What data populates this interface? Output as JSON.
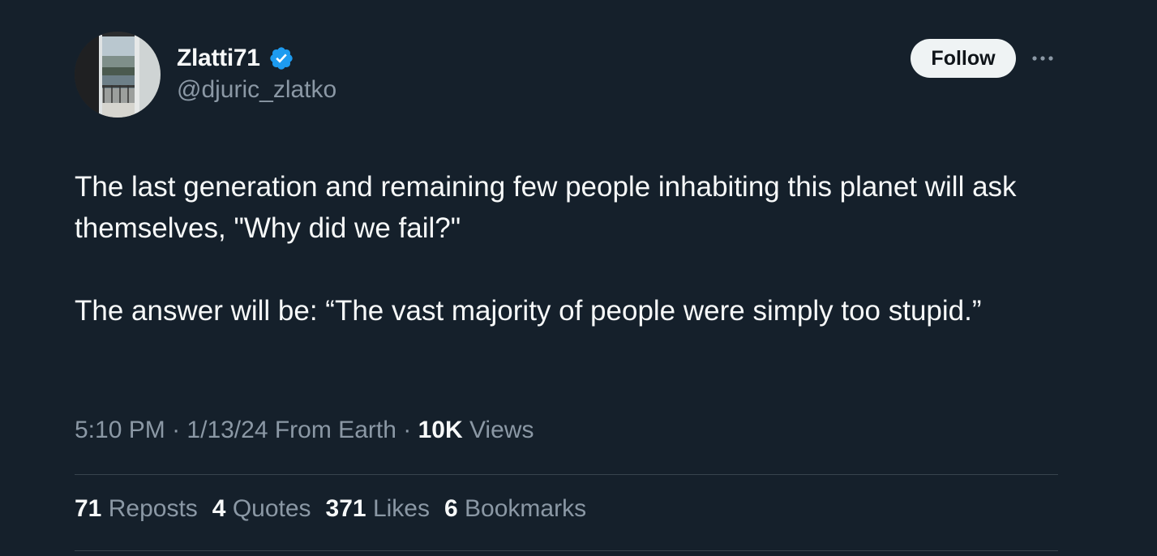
{
  "author": {
    "display_name": "Zlatti71",
    "handle": "@djuric_zlatko",
    "verified": true,
    "avatar_icon": "avatar-photo"
  },
  "actions": {
    "follow_label": "Follow",
    "more_icon": "more-horizontal-icon"
  },
  "tweet": {
    "paragraphs": [
      "The last generation and remaining few people inhabiting this planet will ask themselves, \"Why did we fail?\"",
      "The answer will be: “The vast majority of people were simply too stupid.”"
    ]
  },
  "meta": {
    "time": "5:10 PM",
    "date": "1/13/24",
    "source": "From Earth",
    "separator": "·",
    "views_count": "10K",
    "views_label": "Views"
  },
  "stats": {
    "reposts": {
      "count": "71",
      "label": "Reposts"
    },
    "quotes": {
      "count": "4",
      "label": "Quotes"
    },
    "likes": {
      "count": "371",
      "label": "Likes"
    },
    "bookmarks": {
      "count": "6",
      "label": "Bookmarks"
    }
  },
  "colors": {
    "background": "#15202b",
    "text_primary": "#f7f9f9",
    "text_secondary": "#8b98a5",
    "verified_blue": "#1d9bf0",
    "follow_bg": "#eff3f4",
    "divider": "#38444d"
  }
}
